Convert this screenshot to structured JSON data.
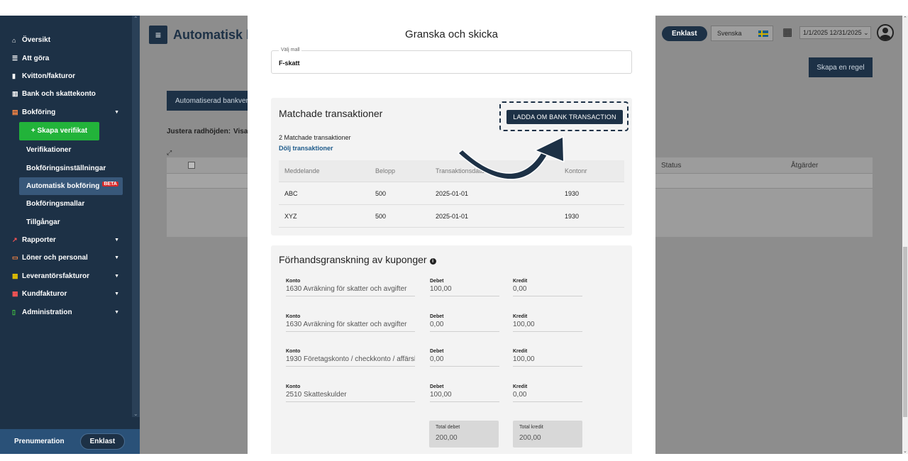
{
  "sidebar": {
    "items": [
      {
        "label": "Översikt",
        "icon": "home-icon"
      },
      {
        "label": "Att göra",
        "icon": "list-icon"
      },
      {
        "label": "Kvitton/fakturor",
        "icon": "receipt-icon"
      },
      {
        "label": "Bank och skattekonto",
        "icon": "bank-icon"
      },
      {
        "label": "Bokföring",
        "icon": "book-icon"
      }
    ],
    "create_button": "+ Skapa verifikat",
    "sub_items": [
      "Verifikationer",
      "Bokföringsinställningar",
      "Automatisk bokföring",
      "Bokföringsmallar",
      "Tillgångar"
    ],
    "beta_badge": "BETA",
    "groups": [
      "Rapporter",
      "Löner och personal",
      "Leverantörsfakturor",
      "Kundfakturor",
      "Administration"
    ],
    "subscription_label": "Prenumeration",
    "plan_pill": "Enklast"
  },
  "background": {
    "page_title": "Automatisk b",
    "tab_label": "Automatiserad bankverk",
    "adjust_label": "Justera radhöjden:",
    "adjust_value": "Visa",
    "col_status": "Status",
    "col_actions": "Åtgärder",
    "plan": "Enklast",
    "language": "Svenska",
    "date_range": "1/1/2025 12/31/2025 ⌄",
    "create_rule": "Skapa en regel"
  },
  "modal": {
    "title": "Granska och skicka",
    "template_label": "Välj mall",
    "template_value": "F-skatt",
    "matched": {
      "heading": "Matchade transaktioner",
      "reload_button": "LADDA OM BANK TRANSACTION",
      "count_text": "2 Matchade transaktioner",
      "hide_link": "Dölj transaktioner",
      "columns": [
        "Meddelande",
        "Belopp",
        "Transaktionsdatum",
        "Kontonr"
      ],
      "rows": [
        [
          "ABC",
          "500",
          "2025-01-01",
          "1930"
        ],
        [
          "XYZ",
          "500",
          "2025-01-01",
          "1930"
        ]
      ]
    },
    "preview": {
      "heading": "Förhandsgranskning av kuponger",
      "konto_label": "Konto",
      "debet_label": "Debet",
      "kredit_label": "Kredit",
      "rows": [
        {
          "konto": "1630 Avräkning för skatter och avgifter",
          "debet": "100,00",
          "kredit": "0,00"
        },
        {
          "konto": "1630 Avräkning för skatter och avgifter",
          "debet": "0,00",
          "kredit": "100,00"
        },
        {
          "konto": "1930 Företagskonto / checkkonto / affärskonto",
          "debet": "0,00",
          "kredit": "100,00"
        },
        {
          "konto": "2510 Skatteskulder",
          "debet": "100,00",
          "kredit": "0,00"
        }
      ],
      "total_debet_label": "Total debet",
      "total_debet": "200,00",
      "total_kredit_label": "Total kredit",
      "total_kredit": "200,00"
    }
  },
  "colors": {
    "navy": "#1d3146",
    "green": "#22b33a",
    "active_nav": "#38587a",
    "beta_red": "#d62828"
  }
}
